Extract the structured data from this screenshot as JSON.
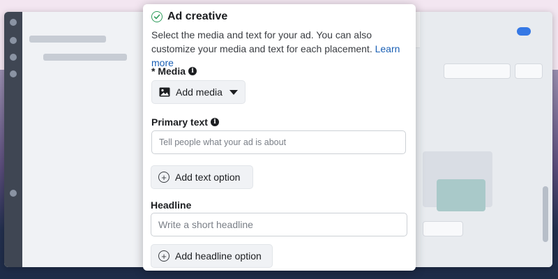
{
  "dialog": {
    "title": "Ad creative",
    "description": "Select the media and text for your ad. You can also customize your media and text for each placement.",
    "learn_more": "Learn more",
    "media": {
      "required_mark": "* ",
      "label": "Media",
      "button_label": "Add media"
    },
    "primary_text": {
      "label": "Primary text",
      "placeholder": "Tell people what your ad is about",
      "add_option_label": "Add text option"
    },
    "headline": {
      "label": "Headline",
      "placeholder": "Write a short headline",
      "add_option_label": "Add headline option"
    }
  },
  "icons": {
    "header": "check-circle-icon",
    "info": "info-icon",
    "media": "image-icon",
    "dropdown": "caret-down-icon",
    "add": "plus-circle-icon"
  },
  "colors": {
    "accent_link": "#1a5fb4",
    "success": "#2e9c5b",
    "button_bg": "#f0f2f5",
    "text": "#1c1e21"
  }
}
